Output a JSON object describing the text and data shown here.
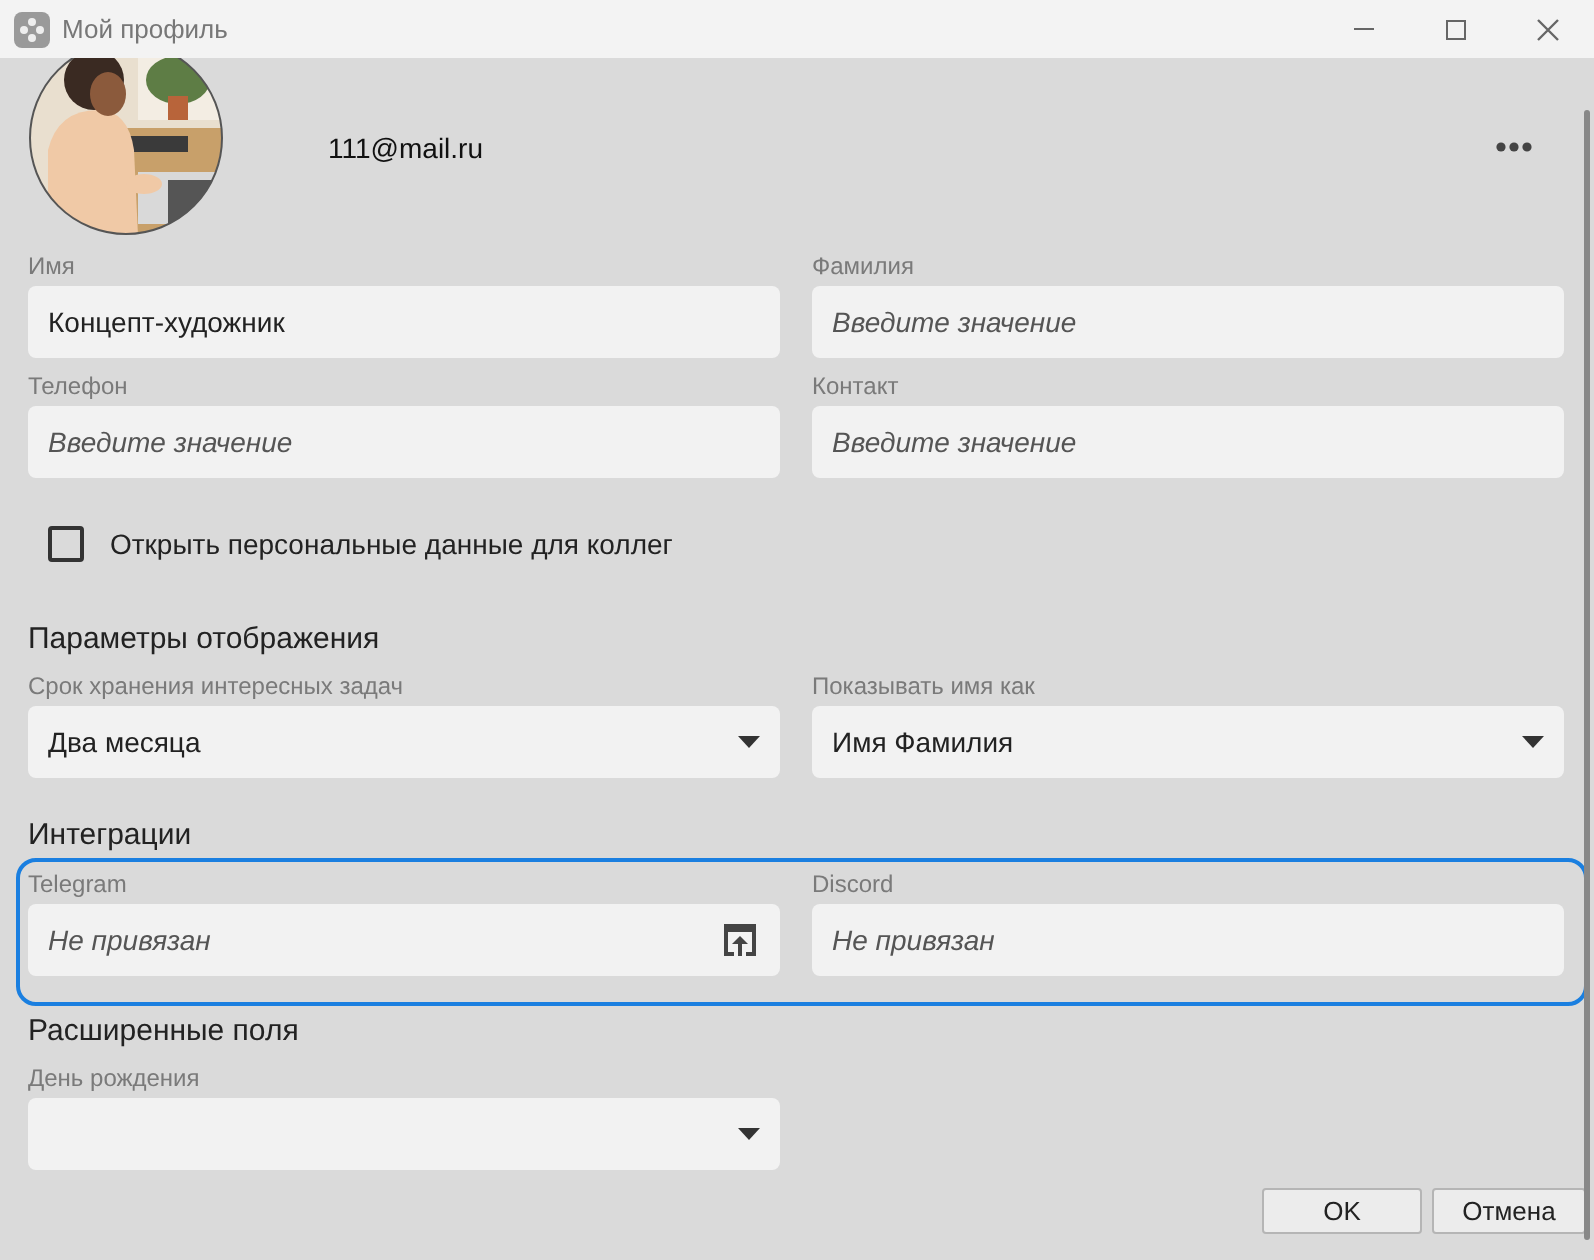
{
  "window": {
    "title": "Мой профиль"
  },
  "profile": {
    "email": "111@mail.ru"
  },
  "personal_fields": [
    {
      "kind": "text",
      "label": "Имя",
      "value": "Концепт-художник"
    },
    {
      "kind": "text",
      "label": "Фамилия",
      "placeholder": "Введите значение"
    },
    {
      "kind": "text",
      "label": "Телефон",
      "placeholder": "Введите значение"
    },
    {
      "kind": "text",
      "label": "Контакт",
      "placeholder": "Введите значение"
    }
  ],
  "share_checkbox": {
    "label": "Открыть персональные данные для коллег",
    "checked": false
  },
  "display_settings": {
    "heading": "Параметры отображения",
    "highlighted": false,
    "fields": [
      {
        "kind": "select",
        "label": "Срок хранения интересных задач",
        "value": "Два месяца"
      },
      {
        "kind": "select",
        "label": "Показывать имя как",
        "value": "Имя Фамилия"
      }
    ]
  },
  "integrations": {
    "heading": "Интеграции",
    "highlighted": true,
    "fields": [
      {
        "kind": "link",
        "label": "Telegram",
        "placeholder": "Не привязан"
      },
      {
        "kind": "text",
        "label": "Discord",
        "placeholder": "Не привязан"
      }
    ]
  },
  "extended_fields": {
    "heading": "Расширенные поля",
    "highlighted": false,
    "fields": [
      {
        "kind": "select",
        "label": "День рождения"
      }
    ]
  },
  "buttons": [
    {
      "label": "OK"
    },
    {
      "label": "Отмена"
    }
  ]
}
